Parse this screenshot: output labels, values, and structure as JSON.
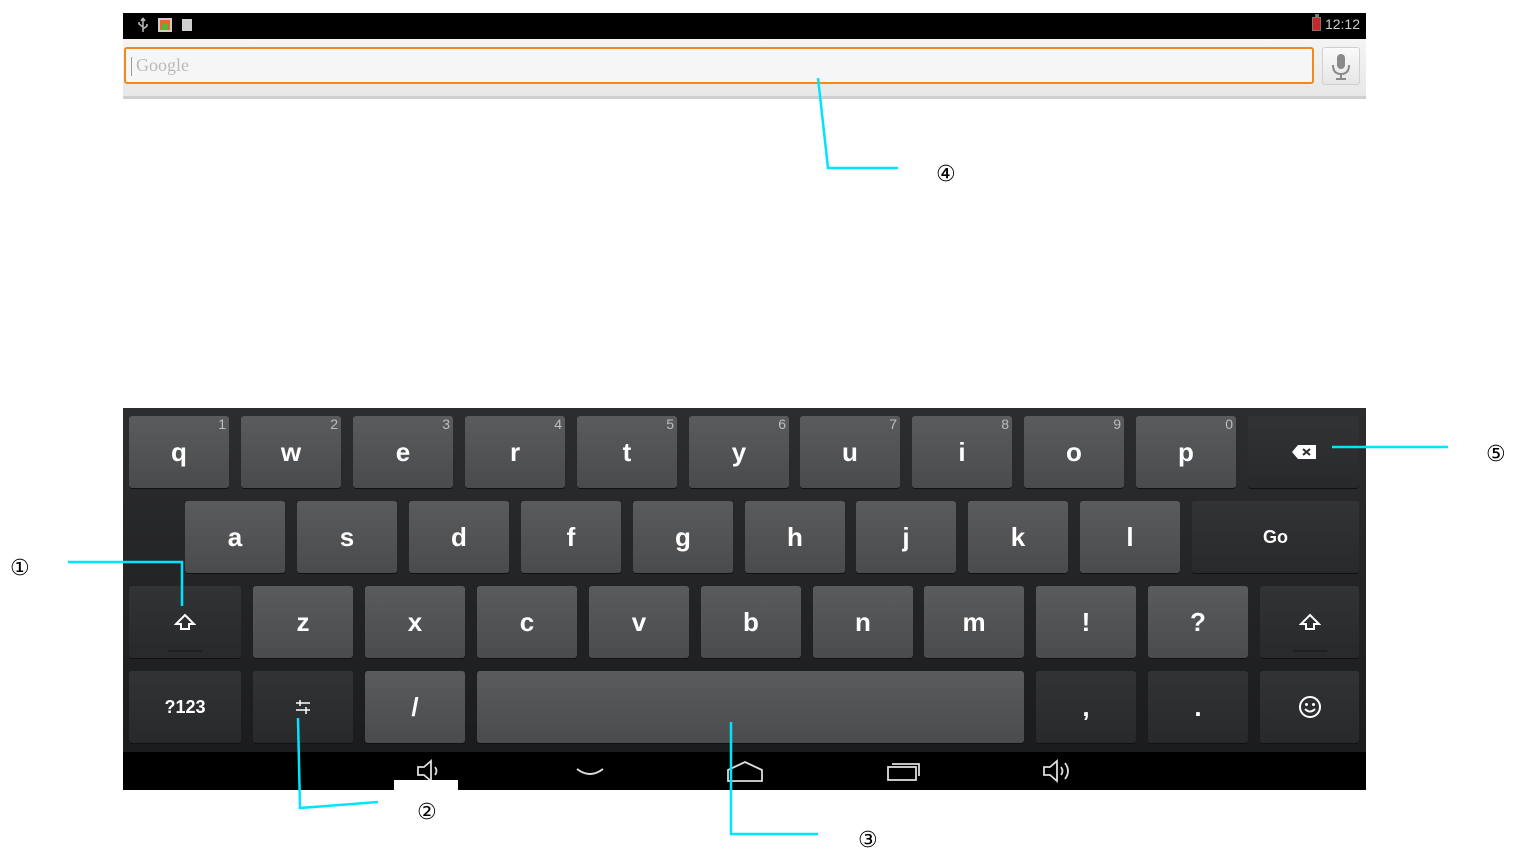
{
  "status_bar": {
    "time": "12:12",
    "icons": [
      "usb-icon",
      "gallery-icon",
      "notification-icon"
    ],
    "battery_color": "#c62828"
  },
  "search": {
    "placeholder": "Google",
    "accent_color": "#f08a1c"
  },
  "keyboard": {
    "rows": [
      [
        {
          "label": "q",
          "hint": "1"
        },
        {
          "label": "w",
          "hint": "2"
        },
        {
          "label": "e",
          "hint": "3"
        },
        {
          "label": "r",
          "hint": "4"
        },
        {
          "label": "t",
          "hint": "5"
        },
        {
          "label": "y",
          "hint": "6"
        },
        {
          "label": "u",
          "hint": "7"
        },
        {
          "label": "i",
          "hint": "8"
        },
        {
          "label": "o",
          "hint": "9"
        },
        {
          "label": "p",
          "hint": "0"
        }
      ],
      [
        {
          "label": "a"
        },
        {
          "label": "s"
        },
        {
          "label": "d"
        },
        {
          "label": "f"
        },
        {
          "label": "g"
        },
        {
          "label": "h"
        },
        {
          "label": "j"
        },
        {
          "label": "k"
        },
        {
          "label": "l"
        }
      ],
      [
        {
          "label": "z"
        },
        {
          "label": "x"
        },
        {
          "label": "c"
        },
        {
          "label": "v"
        },
        {
          "label": "b"
        },
        {
          "label": "n"
        },
        {
          "label": "m"
        },
        {
          "label": "!"
        },
        {
          "label": "?"
        }
      ],
      [
        {
          "label": "/"
        },
        {
          "label": ","
        },
        {
          "label": "."
        }
      ]
    ],
    "go_label": "Go",
    "symbols_label": "?123",
    "key_color": "#4f5052",
    "dark_key_color": "#2c2d2f"
  },
  "annotations": {
    "c1": "①",
    "c2": "②",
    "c3": "③",
    "c4": "④",
    "c5": "⑤",
    "line_color": "#00e5ff"
  }
}
